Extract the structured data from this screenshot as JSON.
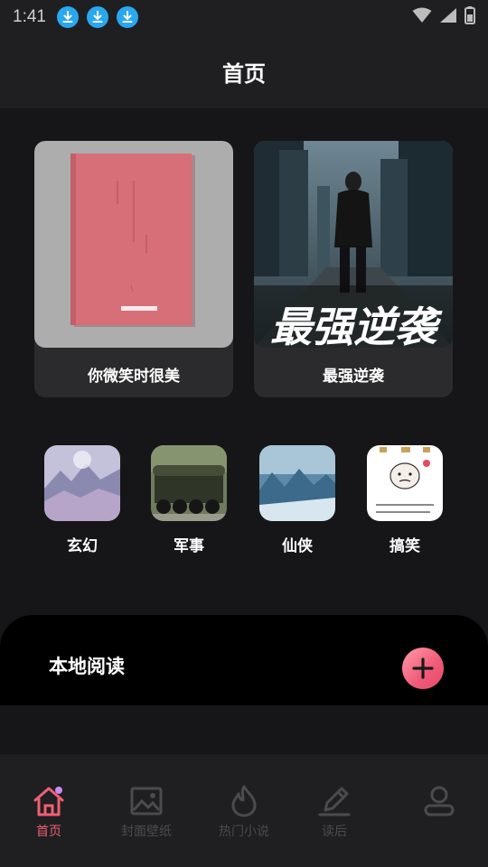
{
  "status_bar": {
    "time": "1:41"
  },
  "header": {
    "title": "首页"
  },
  "books": [
    {
      "title": "你微笑时很美"
    },
    {
      "title": "最强逆袭",
      "cover_text": "最强逆袭"
    }
  ],
  "categories": [
    {
      "label": "玄幻"
    },
    {
      "label": "军事"
    },
    {
      "label": "仙侠"
    },
    {
      "label": "搞笑"
    }
  ],
  "local_reading": {
    "title": "本地阅读"
  },
  "bottom_nav": {
    "items": [
      {
        "label": "首页",
        "icon": "home-icon",
        "active": true
      },
      {
        "label": "封面壁纸",
        "icon": "image-icon"
      },
      {
        "label": "热门小说",
        "icon": "flame-icon"
      },
      {
        "label": "读后",
        "icon": "pencil-icon"
      },
      {
        "label": "",
        "icon": "user-icon"
      }
    ]
  },
  "colors": {
    "accent": "#ef5f73",
    "background": "#161618",
    "card": "#2b2b2d",
    "download": "#29a8f0"
  }
}
